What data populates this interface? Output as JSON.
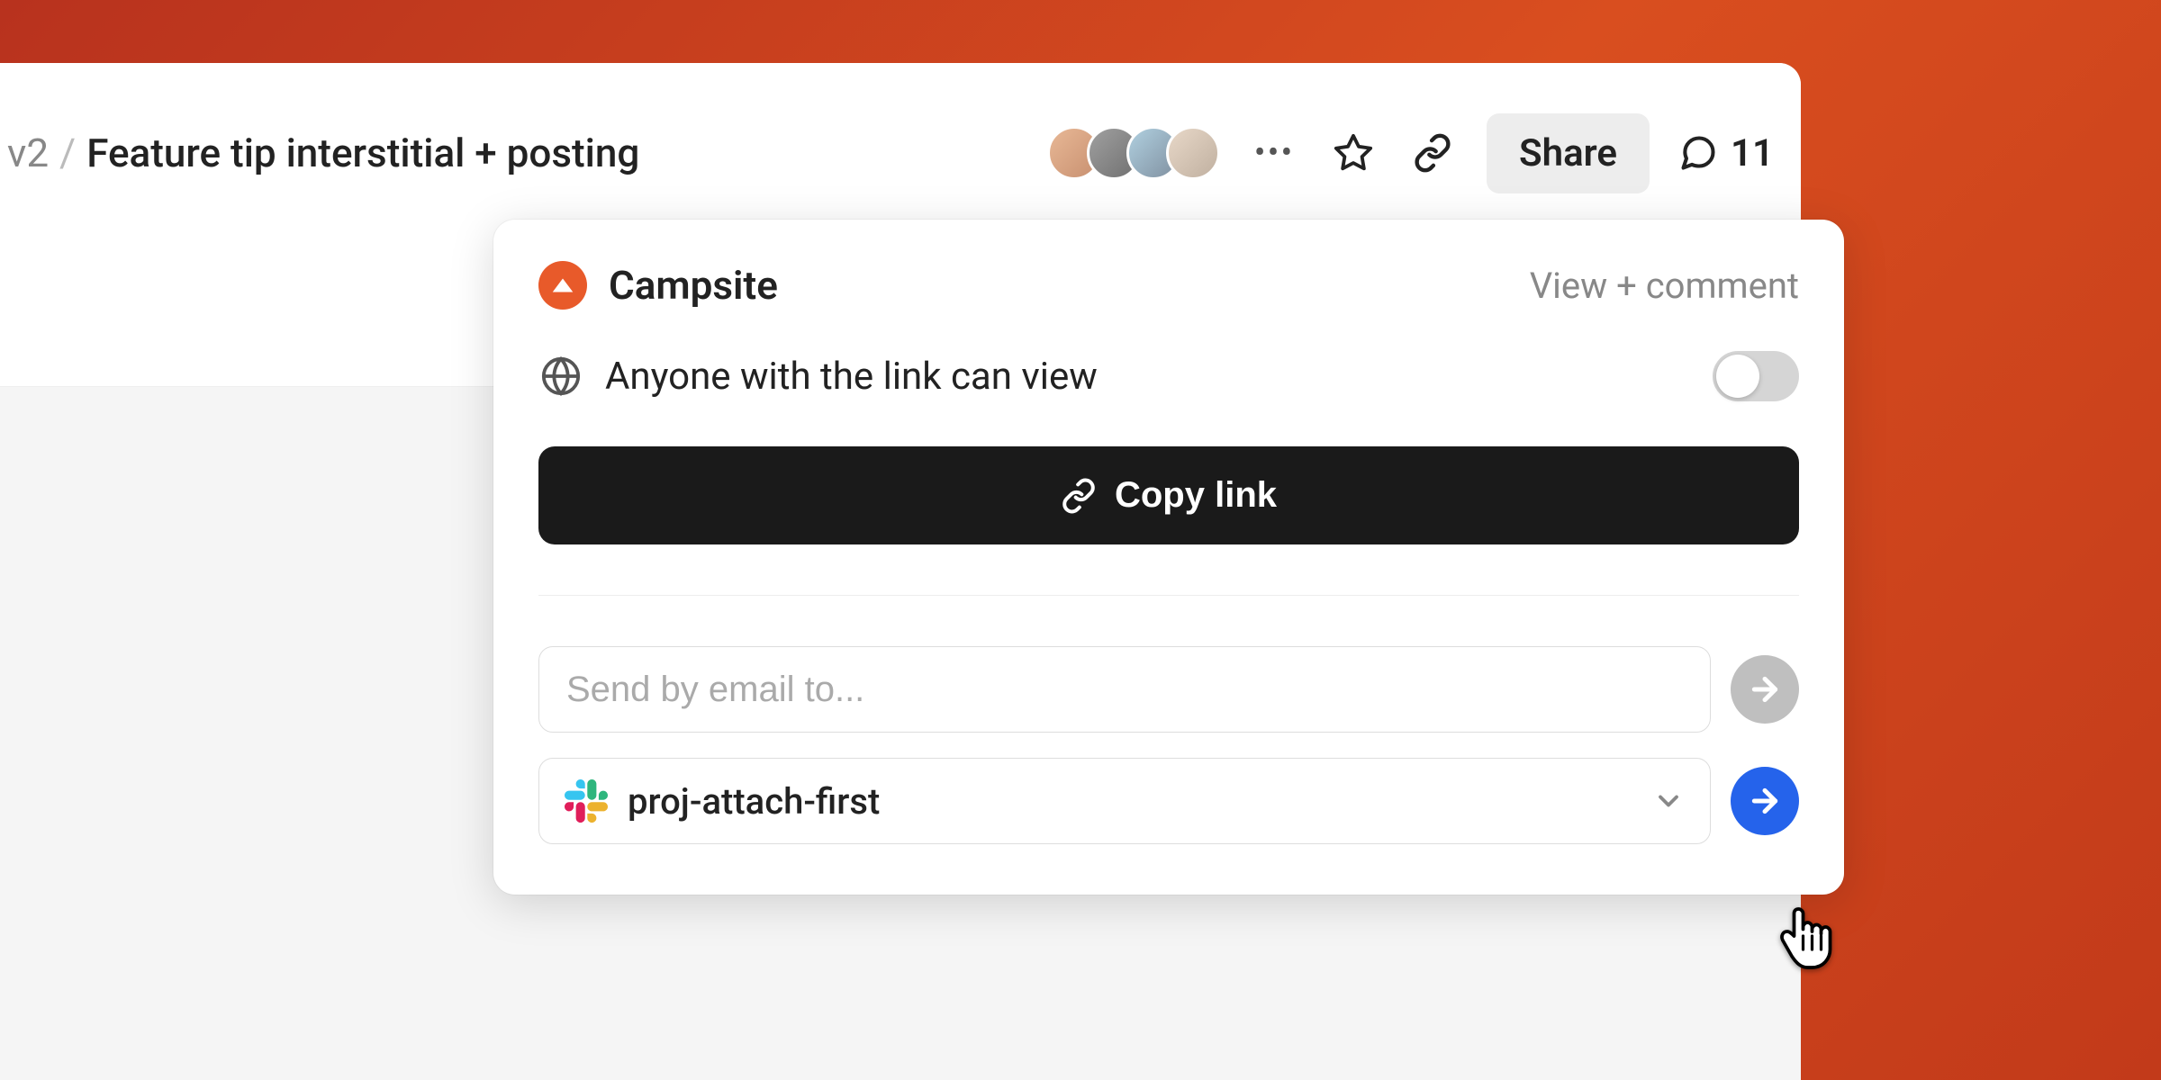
{
  "header": {
    "breadcrumb_prefix": "v2",
    "breadcrumb_sep": "/",
    "breadcrumb_title": "Feature tip interstitial + posting",
    "share_label": "Share",
    "comment_count": "11"
  },
  "share_popup": {
    "org_name": "Campsite",
    "permission_label": "View + comment",
    "link_access_label": "Anyone with the link can view",
    "link_toggle_on": false,
    "copy_link_label": "Copy link",
    "email_placeholder": "Send by email to...",
    "slack_channel": "proj-attach-first"
  }
}
